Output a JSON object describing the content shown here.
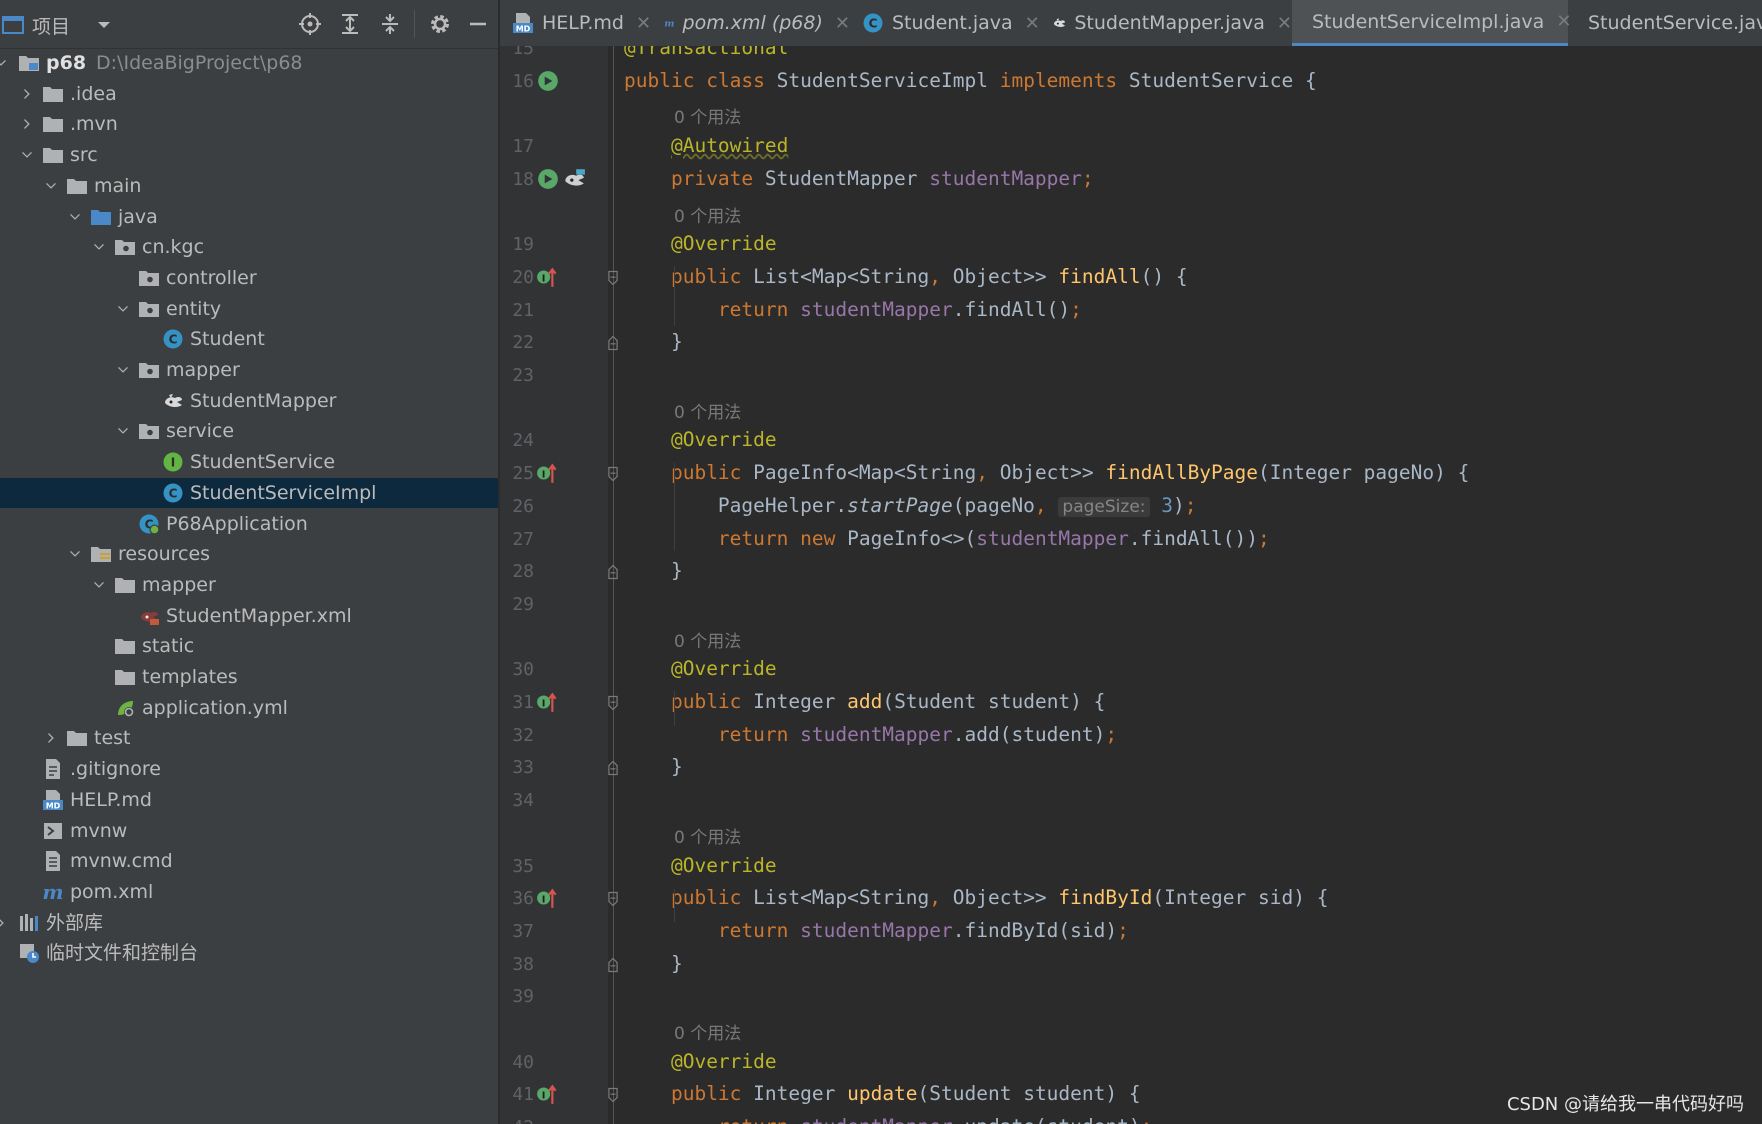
{
  "panel": {
    "title": "项目"
  },
  "tree": [
    {
      "label": "p68",
      "note": "D:\\IdeaBigProject\\p68",
      "bold": true,
      "depth": 0,
      "expanded": true,
      "icon": "module-folder-icon"
    },
    {
      "label": ".idea",
      "depth": 1,
      "expanded": false,
      "icon": "folder-icon"
    },
    {
      "label": ".mvn",
      "depth": 1,
      "expanded": false,
      "icon": "folder-icon"
    },
    {
      "label": "src",
      "depth": 1,
      "expanded": true,
      "icon": "folder-icon"
    },
    {
      "label": "main",
      "depth": 2,
      "expanded": true,
      "icon": "folder-icon"
    },
    {
      "label": "java",
      "depth": 3,
      "expanded": true,
      "icon": "source-folder-icon"
    },
    {
      "label": "cn.kgc",
      "depth": 4,
      "expanded": true,
      "icon": "package-icon"
    },
    {
      "label": "controller",
      "depth": 5,
      "icon": "package-icon"
    },
    {
      "label": "entity",
      "depth": 5,
      "expanded": true,
      "icon": "package-icon"
    },
    {
      "label": "Student",
      "depth": 6,
      "icon": "class-icon"
    },
    {
      "label": "mapper",
      "depth": 5,
      "expanded": true,
      "icon": "package-icon"
    },
    {
      "label": "StudentMapper",
      "depth": 6,
      "icon": "mybatis-icon"
    },
    {
      "label": "service",
      "depth": 5,
      "expanded": true,
      "icon": "package-icon"
    },
    {
      "label": "StudentService",
      "depth": 6,
      "icon": "interface-icon"
    },
    {
      "label": "StudentServiceImpl",
      "depth": 6,
      "icon": "class-icon",
      "selected": true
    },
    {
      "label": "P68Application",
      "depth": 5,
      "icon": "spring-boot-class-icon"
    },
    {
      "label": "resources",
      "depth": 3,
      "expanded": true,
      "icon": "resources-folder-icon"
    },
    {
      "label": "mapper",
      "depth": 4,
      "expanded": true,
      "icon": "folder-icon"
    },
    {
      "label": "StudentMapper.xml",
      "depth": 5,
      "icon": "mybatis-xml-icon"
    },
    {
      "label": "static",
      "depth": 4,
      "icon": "folder-icon"
    },
    {
      "label": "templates",
      "depth": 4,
      "icon": "folder-icon"
    },
    {
      "label": "application.yml",
      "depth": 4,
      "icon": "spring-yml-icon"
    },
    {
      "label": "test",
      "depth": 2,
      "expanded": false,
      "icon": "folder-icon"
    },
    {
      "label": ".gitignore",
      "depth": 1,
      "icon": "gitignore-file-icon"
    },
    {
      "label": "HELP.md",
      "depth": 1,
      "icon": "markdown-file-icon"
    },
    {
      "label": "mvnw",
      "depth": 1,
      "icon": "shell-script-icon"
    },
    {
      "label": "mvnw.cmd",
      "depth": 1,
      "icon": "text-file-icon"
    },
    {
      "label": "pom.xml",
      "depth": 1,
      "icon": "maven-icon"
    },
    {
      "label": "外部库",
      "depth": 0,
      "expanded": false,
      "icon": "library-icon"
    },
    {
      "label": "临时文件和控制台",
      "depth": 0,
      "icon": "scratches-icon"
    }
  ],
  "tabs": [
    {
      "label": "HELP.md",
      "icon": "markdown-file-icon"
    },
    {
      "label": "pom.xml (p68)",
      "icon": "maven-icon",
      "italic": true
    },
    {
      "label": "Student.java",
      "icon": "class-icon"
    },
    {
      "label": "StudentMapper.java",
      "icon": "mybatis-icon"
    },
    {
      "label": "StudentServiceImpl.java",
      "icon": "class-icon",
      "active": true
    },
    {
      "label": "StudentService.java",
      "icon": "interface-icon"
    }
  ],
  "editor": {
    "usage_hint": "0 个用法",
    "param_hint": "pageSize:",
    "lines": [
      {
        "n": "15",
        "t": "@Transactional"
      },
      {
        "n": "16",
        "t": "public class StudentServiceImpl implements StudentService {"
      },
      {
        "n": "17",
        "t": "    @Autowired"
      },
      {
        "n": "18",
        "t": "    private StudentMapper studentMapper;"
      },
      {
        "n": "19",
        "t": "    @Override"
      },
      {
        "n": "20",
        "t": "    public List<Map<String, Object>> findAll() {"
      },
      {
        "n": "21",
        "t": "        return studentMapper.findAll();"
      },
      {
        "n": "22",
        "t": "    }"
      },
      {
        "n": "23",
        "t": ""
      },
      {
        "n": "24",
        "t": "    @Override"
      },
      {
        "n": "25",
        "t": "    public PageInfo<Map<String, Object>> findAllByPage(Integer pageNo) {"
      },
      {
        "n": "26",
        "t": "        PageHelper.startPage(pageNo, 3);"
      },
      {
        "n": "27",
        "t": "        return new PageInfo<>(studentMapper.findAll());"
      },
      {
        "n": "28",
        "t": "    }"
      },
      {
        "n": "29",
        "t": ""
      },
      {
        "n": "30",
        "t": "    @Override"
      },
      {
        "n": "31",
        "t": "    public Integer add(Student student) {"
      },
      {
        "n": "32",
        "t": "        return studentMapper.add(student);"
      },
      {
        "n": "33",
        "t": "    }"
      },
      {
        "n": "34",
        "t": ""
      },
      {
        "n": "35",
        "t": "    @Override"
      },
      {
        "n": "36",
        "t": "    public List<Map<String, Object>> findById(Integer sid) {"
      },
      {
        "n": "37",
        "t": "        return studentMapper.findById(sid);"
      },
      {
        "n": "38",
        "t": "    }"
      },
      {
        "n": "39",
        "t": ""
      },
      {
        "n": "40",
        "t": "    @Override"
      },
      {
        "n": "41",
        "t": "    public Integer update(Student student) {"
      },
      {
        "n": "42",
        "t": "        return studentMapper.update(student);"
      }
    ]
  },
  "watermark": "CSDN @请给我一串代码好吗",
  "colors": {
    "keyword": "#cc7832",
    "annotation": "#bbb529",
    "field": "#9876aa",
    "method_decl": "#ffc66d",
    "number": "#6897bb",
    "selection": "#0d293e",
    "active_tab_underline": "#4a88c7"
  }
}
